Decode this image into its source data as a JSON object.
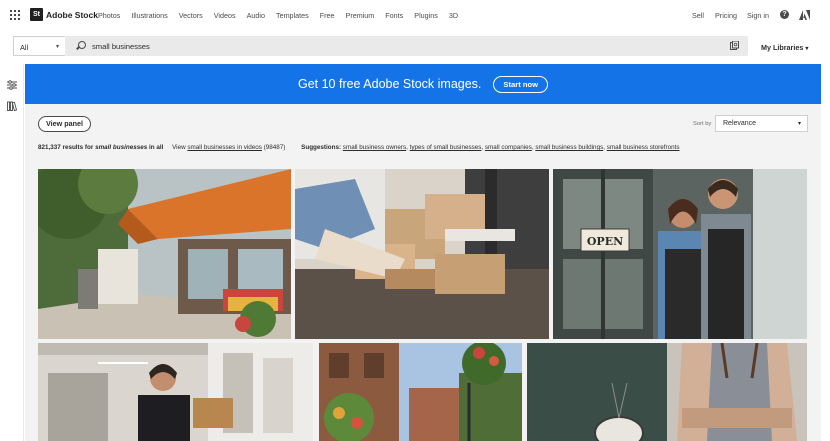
{
  "header": {
    "logo_badge": "St",
    "logo_text": "Adobe Stock",
    "nav": [
      "Photos",
      "Illustrations",
      "Vectors",
      "Videos",
      "Audio",
      "Templates",
      "Free",
      "Premium",
      "Fonts",
      "Plugins",
      "3D"
    ],
    "sell": "Sell",
    "pricing": "Pricing",
    "sign_in": "Sign in",
    "help_glyph": "?"
  },
  "search": {
    "category": "All",
    "query": "small businesses",
    "my_libraries": "My Libraries"
  },
  "banner": {
    "text": "Get 10 free Adobe Stock images.",
    "cta": "Start now",
    "color": "#1473e6"
  },
  "toolbar": {
    "view_panel": "View panel",
    "sort_label": "Sort by",
    "sort_value": "Relevance"
  },
  "results": {
    "count_text": "821,337 results for",
    "query": "small businesses",
    "scope": "in all",
    "view_prefix": "View",
    "video_link": "small businesses in videos",
    "video_count": "(98487)",
    "suggestions_label": "Suggestions:",
    "suggestions": [
      "small business owners",
      "types of small businesses",
      "small companies",
      "small business buildings",
      "small business storefronts"
    ]
  },
  "images": {
    "open_sign": "OPEN"
  },
  "icons": [
    "app-grid-icon",
    "search-icon",
    "visual-search-icon",
    "help-icon",
    "adobe-logo-icon",
    "filter-icon",
    "libraries-icon",
    "chevron-down-icon"
  ]
}
